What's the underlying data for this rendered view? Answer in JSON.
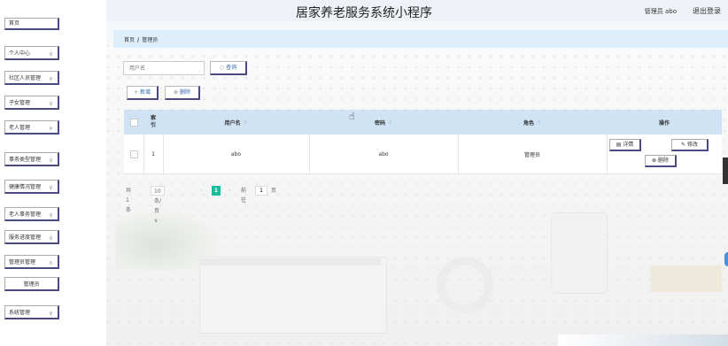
{
  "app": {
    "title": "居家养老服务系统小程序",
    "user": "管理员 abo",
    "logout": "退出登录"
  },
  "sidebar": {
    "items": [
      {
        "label": "首页"
      },
      {
        "label": "个人中心"
      },
      {
        "label": "社区人员管理"
      },
      {
        "label": "子女管理"
      },
      {
        "label": "老人管理"
      },
      {
        "label": "事务类型管理"
      },
      {
        "label": "健康情况管理"
      },
      {
        "label": "老人事务管理"
      },
      {
        "label": "服务进度管理"
      },
      {
        "label": "管理员管理"
      },
      {
        "label": "管理员"
      },
      {
        "label": "系统管理"
      }
    ]
  },
  "breadcrumb": {
    "home": "首页",
    "sep": "/",
    "current": "管理员"
  },
  "search": {
    "placeholder": "用户名",
    "button": "查询",
    "button_icon": "search-icon"
  },
  "toolbar": {
    "add": "新增",
    "add_icon": "plus-icon",
    "delete": "删除",
    "delete_icon": "trash-icon"
  },
  "table": {
    "columns": [
      "索引",
      "用户名",
      "密码",
      "角色",
      "操作"
    ],
    "rows": [
      {
        "index": "1",
        "username": "abo",
        "password": "abo",
        "role": "管理员",
        "actions": {
          "detail": "详情",
          "edit": "修改",
          "delete": "删除"
        }
      }
    ]
  },
  "pagination": {
    "total_label": "共 1 条",
    "page_size": "10条/页",
    "current_page": "1",
    "goto_label": "前往",
    "goto_value": "1",
    "page_unit": "页"
  },
  "colors": {
    "header": "#eef1f6",
    "breadcrumb_bg": "#deeefa",
    "table_header": "#cfe3f5",
    "accent": "#1bbc9b",
    "border": "#4a4a80"
  }
}
